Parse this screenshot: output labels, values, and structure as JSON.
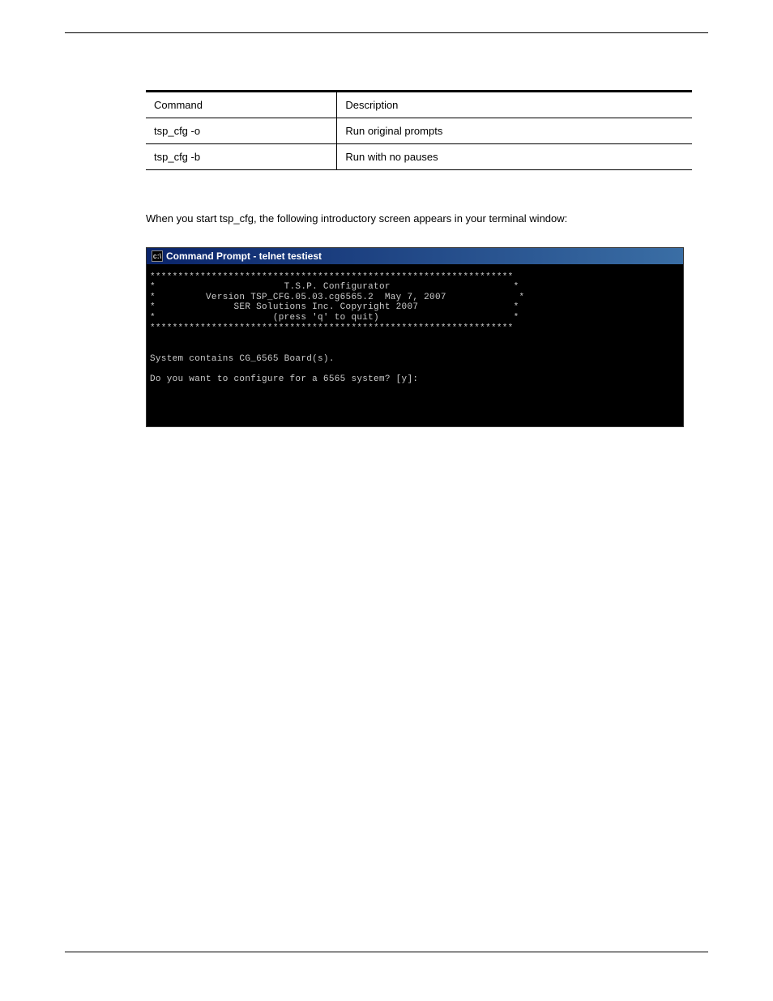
{
  "table": {
    "headers": [
      "Command",
      "Description"
    ],
    "rows": [
      [
        "tsp_cfg -o",
        "Run original prompts"
      ],
      [
        "tsp_cfg -b",
        "Run with no pauses"
      ]
    ]
  },
  "intro": "When you start tsp_cfg, the following introductory screen appears in your terminal window:",
  "terminal": {
    "title": "Command Prompt - telnet testiest",
    "lines": [
      "*****************************************************************",
      "*                       T.S.P. Configurator                      *",
      "*         Version TSP_CFG.05.03.cg6565.2  May 7, 2007             *",
      "*              SER Solutions Inc. Copyright 2007                 *",
      "*                     (press 'q' to quit)                        *",
      "*****************************************************************",
      "",
      "",
      "System contains CG_6565 Board(s).",
      "",
      "Do you want to configure for a 6565 system? [y]:"
    ]
  }
}
